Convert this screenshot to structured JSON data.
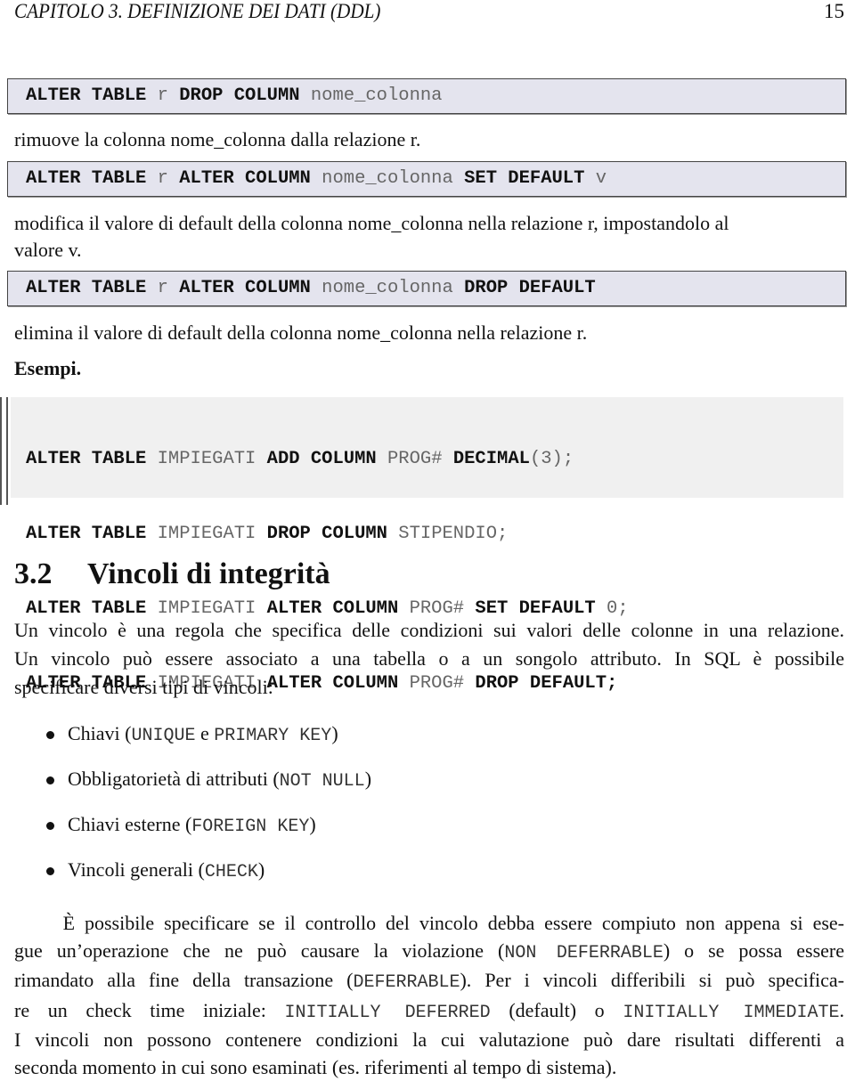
{
  "header": {
    "chapter_title": "CAPITOLO 3.  DEFINIZIONE DEI DATI (DDL)",
    "page_number": "15"
  },
  "syntax_boxes": [
    {
      "tokens": [
        {
          "t": "ALTER TABLE",
          "k": true
        },
        {
          "t": " r ",
          "k": false
        },
        {
          "t": "DROP COLUMN",
          "k": true
        },
        {
          "t": " nome_colonna",
          "k": false
        }
      ]
    },
    {
      "tokens": [
        {
          "t": "ALTER TABLE",
          "k": true
        },
        {
          "t": " r ",
          "k": false
        },
        {
          "t": "ALTER COLUMN",
          "k": true
        },
        {
          "t": " nome_colonna ",
          "k": false
        },
        {
          "t": "SET DEFAULT",
          "k": true
        },
        {
          "t": " v",
          "k": false
        }
      ]
    },
    {
      "tokens": [
        {
          "t": "ALTER TABLE",
          "k": true
        },
        {
          "t": " r ",
          "k": false
        },
        {
          "t": "ALTER COLUMN",
          "k": true
        },
        {
          "t": " nome_colonna ",
          "k": false
        },
        {
          "t": "DROP DEFAULT",
          "k": true
        }
      ]
    }
  ],
  "descriptions": {
    "drop_column": "rimuove la colonna nome_colonna dalla relazione r.",
    "set_default_line1": "modifica il valore di default della colonna nome_colonna nella relazione r, impostandolo al",
    "set_default_line2": "valore v.",
    "drop_default": "elimina il valore di default della colonna nome_colonna nella relazione r."
  },
  "examples_label": "Esempi.",
  "examples": [
    [
      {
        "t": "ALTER TABLE",
        "k": true
      },
      {
        "t": " IMPIEGATI ",
        "k": false
      },
      {
        "t": "ADD COLUMN",
        "k": true
      },
      {
        "t": " PROG# ",
        "k": false
      },
      {
        "t": "DECIMAL",
        "k": true
      },
      {
        "t": "(3);",
        "k": false
      }
    ],
    [
      {
        "t": "ALTER TABLE",
        "k": true
      },
      {
        "t": " IMPIEGATI ",
        "k": false
      },
      {
        "t": "DROP COLUMN",
        "k": true
      },
      {
        "t": " STIPENDIO;",
        "k": false
      }
    ],
    [
      {
        "t": "ALTER TABLE",
        "k": true
      },
      {
        "t": " IMPIEGATI ",
        "k": false
      },
      {
        "t": "ALTER COLUMN",
        "k": true
      },
      {
        "t": " PROG# ",
        "k": false
      },
      {
        "t": "SET DEFAULT",
        "k": true
      },
      {
        "t": " 0;",
        "k": false
      }
    ],
    [
      {
        "t": "ALTER TABLE",
        "k": true
      },
      {
        "t": " IMPIEGATI ",
        "k": false
      },
      {
        "t": "ALTER COLUMN",
        "k": true
      },
      {
        "t": " PROG# ",
        "k": false
      },
      {
        "t": "DROP DEFAULT;",
        "k": true
      }
    ]
  ],
  "section": {
    "number": "3.2",
    "title": "Vincoli di integrità"
  },
  "intro_lines": [
    "Un vincolo è una regola che specifica delle condizioni sui valori delle colonne in una relazione.",
    "Un vincolo può essere associato a una tabella o a un songolo attributo.  In SQL è possibile",
    "specificare diversi tipi di vincoli:"
  ],
  "bullets": [
    [
      {
        "t": "Chiavi (",
        "m": false
      },
      {
        "t": "UNIQUE",
        "m": true
      },
      {
        "t": " e ",
        "m": false
      },
      {
        "t": "PRIMARY KEY",
        "m": true
      },
      {
        "t": ")",
        "m": false
      }
    ],
    [
      {
        "t": "Obbligatorietà di attributi (",
        "m": false
      },
      {
        "t": "NOT NULL",
        "m": true
      },
      {
        "t": ")",
        "m": false
      }
    ],
    [
      {
        "t": "Chiavi esterne (",
        "m": false
      },
      {
        "t": "FOREIGN KEY",
        "m": true
      },
      {
        "t": ")",
        "m": false
      }
    ],
    [
      {
        "t": "Vincoli generali (",
        "m": false
      },
      {
        "t": "CHECK",
        "m": true
      },
      {
        "t": ")",
        "m": false
      }
    ]
  ],
  "final_paragraph_lines": [
    [
      {
        "t": "     È possibile specificare se il controllo del vincolo debba essere compiuto non appena si ese-",
        "m": false
      }
    ],
    [
      {
        "t": "gue un’operazione che ne può causare la violazione (",
        "m": false
      },
      {
        "t": "NON DEFERRABLE",
        "m": true
      },
      {
        "t": ") o se possa essere",
        "m": false
      }
    ],
    [
      {
        "t": "rimandato alla fine della transazione (",
        "m": false
      },
      {
        "t": "DEFERRABLE",
        "m": true
      },
      {
        "t": "). Per i vincoli differibili si può specifica-",
        "m": false
      }
    ],
    [
      {
        "t": "re un check time iniziale: ",
        "m": false
      },
      {
        "t": "INITIALLY DEFERRED",
        "m": true
      },
      {
        "t": " (default) o ",
        "m": false
      },
      {
        "t": "INITIALLY IMMEDIATE",
        "m": true
      },
      {
        "t": ".",
        "m": false
      }
    ],
    [
      {
        "t": "I vincoli non possono contenere condizioni la cui valutazione può dare risultati differenti a",
        "m": false
      }
    ],
    [
      {
        "t": "seconda momento in cui sono esaminati (es. riferimenti al tempo di sistema).",
        "m": false
      }
    ]
  ]
}
